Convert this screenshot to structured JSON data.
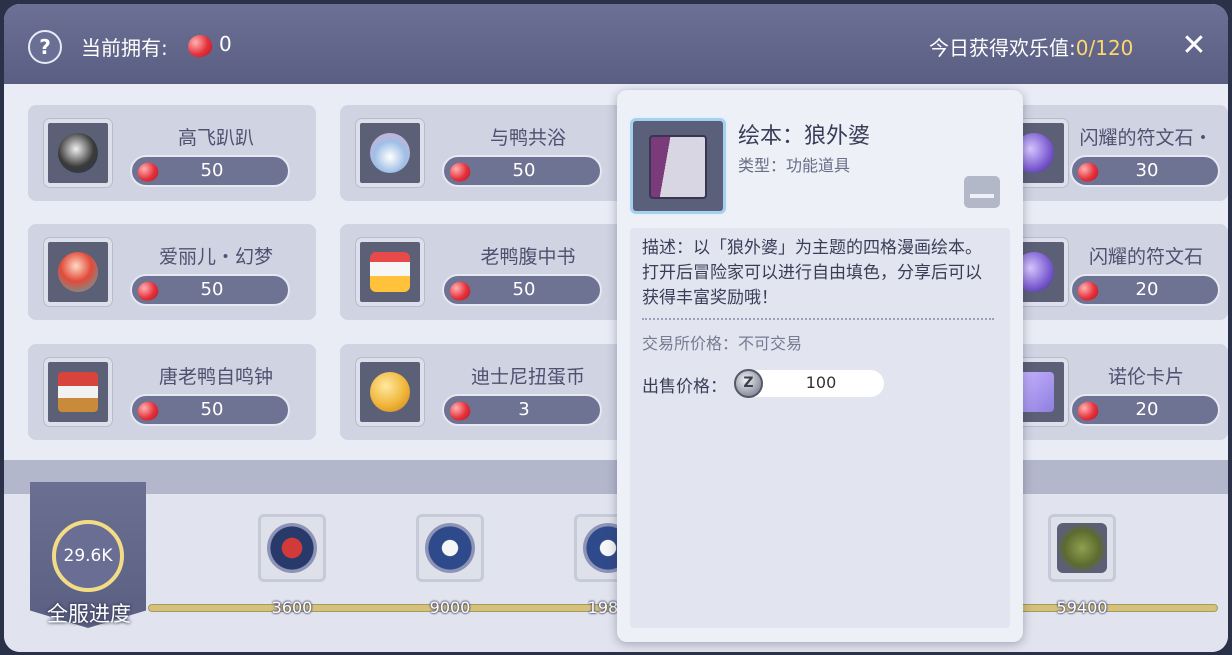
{
  "header": {
    "help_icon": "question-icon",
    "own_label": "当前拥有:",
    "own_count": "0",
    "joy_label": "今日获得欢乐值:",
    "joy_value": "0/120",
    "close_icon": "close-icon",
    "close_symbol": "✕"
  },
  "items": [
    {
      "name": "高飞趴趴",
      "price": "50"
    },
    {
      "name": "与鸭共浴",
      "price": "50"
    },
    {
      "name": "闪耀的符文石・",
      "price": "30"
    },
    {
      "name": "爱丽儿・幻梦",
      "price": "50"
    },
    {
      "name": "老鸭腹中书",
      "price": "50"
    },
    {
      "name": "闪耀的符文石",
      "price": "20"
    },
    {
      "name": "唐老鸭自鸣钟",
      "price": "50"
    },
    {
      "name": "迪士尼扭蛋币",
      "price": "3"
    },
    {
      "name": "诺伦卡片",
      "price": "20"
    }
  ],
  "progress": {
    "value": "29.6K",
    "label": "全服进度",
    "milestones": [
      "3600",
      "9000",
      "1980",
      "59400"
    ]
  },
  "popup": {
    "title": "绘本：狼外婆",
    "type": "类型：功能道具",
    "description": "描述：以「狼外婆」为主题的四格漫画绘本。打开后冒险家可以进行自由填色，分享后可以获得丰富奖励哦！",
    "trade": "交易所价格：不可交易",
    "sell_label": "出售价格：",
    "sell_value": "100",
    "coin_symbol": "Z",
    "inbox_icon": "inbox-icon"
  },
  "colors": {
    "header": "#5a5e82",
    "accent_yellow": "#ffd66e",
    "price_pill": "#6f7393"
  }
}
